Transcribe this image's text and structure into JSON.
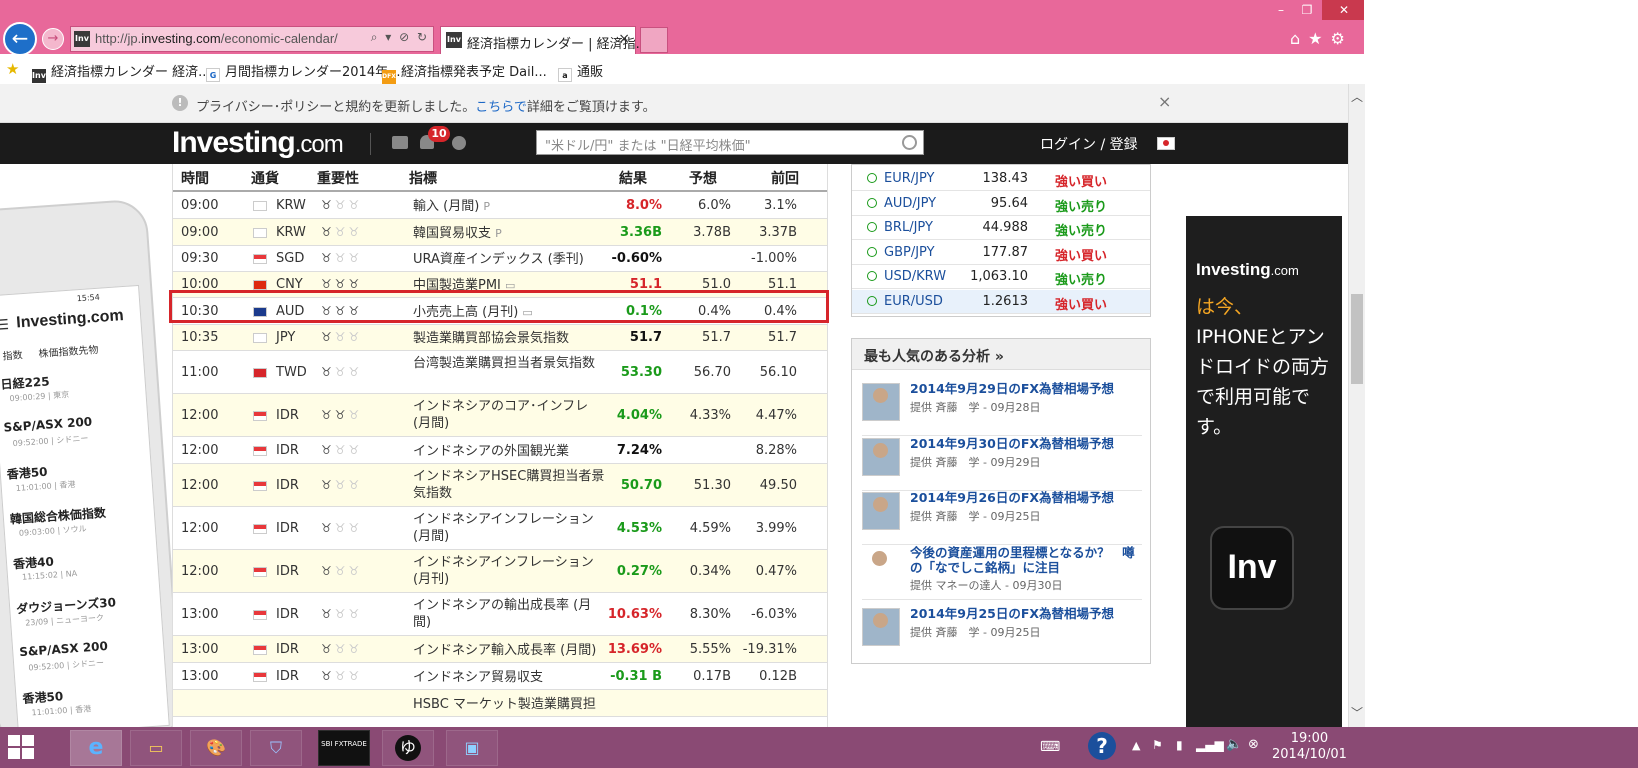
{
  "browser": {
    "url_prefix": "http://jp.",
    "url_domain": "investing.com",
    "url_path": "/economic-calendar/",
    "url_icons": "⌕ ▾ ⊘ ↻",
    "tab_title": "経済指標カレンダー | 経済指...",
    "tab_close": "×",
    "favicon_text": "Inv",
    "win_min": "–",
    "win_restore": "❐",
    "win_close": "✕",
    "tool_icons": "⌂★⚙"
  },
  "favorites": [
    {
      "label": "経済指標カレンダー 経済...",
      "icon": "investing-favicon",
      "color": "#333333",
      "glyph": "Inv"
    },
    {
      "label": "月間指標カレンダー2014年...",
      "icon": "g-favicon",
      "color": "#ffffff",
      "glyph": "G"
    },
    {
      "label": "経済指標発表予定 Dail...",
      "icon": "dfx-favicon",
      "color": "#f39c12",
      "glyph": "DFX"
    },
    {
      "label": "通販",
      "icon": "amazon-favicon",
      "color": "#ffffff",
      "glyph": "a"
    }
  ],
  "notice": {
    "icon": "!",
    "text_before": "プライバシー･ポリシーと規約を更新しました。",
    "link": "こちらで",
    "text_after": "詳細をご覧頂けます。",
    "close": "×"
  },
  "header": {
    "logo_main": "Investing",
    "logo_suffix": ".com",
    "badge_count": "10",
    "search_placeholder": "\"米ドル/円\" または \"日経平均株価\"",
    "login": "ログイン / 登録"
  },
  "phone": {
    "time": "15:54",
    "logo": "Investing.com",
    "menu_icon": "☰",
    "tabs": [
      "指数",
      "株価指数先物"
    ],
    "rows": [
      {
        "name": "日経225",
        "sub": "09:00:29 | 東京"
      },
      {
        "name": "S&P/ASX 200",
        "sub": "09:52:00 | シドニー"
      },
      {
        "name": "香港50",
        "sub": "11:01:00 | 香港"
      },
      {
        "name": "韓国総合株価指数",
        "sub": "09:03:00 | ソウル"
      },
      {
        "name": "香港40",
        "sub": "11:15:02 | NA"
      },
      {
        "name": "ダウジョーンズ30",
        "sub": "23/09 | ニューヨーク"
      },
      {
        "name": "S&P/ASX 200",
        "sub": "09:52:00 | シドニー"
      },
      {
        "name": "香港50",
        "sub": "11:01:00 | 香港"
      }
    ]
  },
  "calendar": {
    "headers": {
      "time": "時間",
      "currency": "通貨",
      "importance": "重要性",
      "indicator": "指標",
      "actual": "結果",
      "forecast": "予想",
      "previous": "前回"
    },
    "bull_glyph": "♉",
    "rows": [
      {
        "time": "09:00",
        "flag": "KR",
        "currency": "KRW",
        "imp": 1,
        "indicator": "輸入 (月間)",
        "tag": "P",
        "actual": "8.0%",
        "ac": "red",
        "forecast": "6.0%",
        "previous": "3.1%"
      },
      {
        "time": "09:00",
        "flag": "KR",
        "currency": "KRW",
        "imp": 1,
        "indicator": "韓国貿易収支",
        "tag": "P",
        "actual": "3.36B",
        "ac": "green",
        "forecast": "3.78B",
        "previous": "3.37B"
      },
      {
        "time": "09:30",
        "flag": "SG",
        "currency": "SGD",
        "imp": 1,
        "indicator": "URA資産インデックス (季刊)",
        "tag": "",
        "actual": "-0.60%",
        "ac": "black",
        "forecast": "",
        "previous": "-1.00%"
      },
      {
        "time": "10:00",
        "flag": "CN",
        "currency": "CNY",
        "imp": 3,
        "indicator": "中国製造業PMI",
        "tag": "bubble",
        "actual": "51.1",
        "ac": "red",
        "forecast": "51.0",
        "previous": "51.1"
      },
      {
        "time": "10:30",
        "flag": "AU",
        "currency": "AUD",
        "imp": 3,
        "indicator": "小売売上高 (月刊)",
        "tag": "bubble",
        "actual": "0.1%",
        "ac": "green",
        "forecast": "0.4%",
        "previous": "0.4%"
      },
      {
        "time": "10:35",
        "flag": "JP",
        "currency": "JPY",
        "imp": 1,
        "indicator": "製造業購買部協会景気指数",
        "tag": "",
        "actual": "51.7",
        "ac": "black",
        "forecast": "51.7",
        "previous": "51.7"
      },
      {
        "time": "11:00",
        "flag": "TW",
        "currency": "TWD",
        "imp": 1,
        "indicator": "台湾製造業購買担当者景気指数",
        "tag": "",
        "actual": "53.30",
        "ac": "green",
        "forecast": "56.70",
        "previous": "56.10"
      },
      {
        "time": "12:00",
        "flag": "ID",
        "currency": "IDR",
        "imp": 2,
        "indicator": "インドネシアのコア･インフレ (月間)",
        "tag": "",
        "actual": "4.04%",
        "ac": "green",
        "forecast": "4.33%",
        "previous": "4.47%"
      },
      {
        "time": "12:00",
        "flag": "ID",
        "currency": "IDR",
        "imp": 1,
        "indicator": "インドネシアの外国観光業",
        "tag": "",
        "actual": "7.24%",
        "ac": "black",
        "forecast": "",
        "previous": "8.28%"
      },
      {
        "time": "12:00",
        "flag": "ID",
        "currency": "IDR",
        "imp": 1,
        "indicator": "インドネシアHSEC購買担当者景気指数",
        "tag": "",
        "actual": "50.70",
        "ac": "green",
        "forecast": "51.30",
        "previous": "49.50"
      },
      {
        "time": "12:00",
        "flag": "ID",
        "currency": "IDR",
        "imp": 1,
        "indicator": "インドネシアインフレーション (月間)",
        "tag": "",
        "actual": "4.53%",
        "ac": "green",
        "forecast": "4.59%",
        "previous": "3.99%"
      },
      {
        "time": "12:00",
        "flag": "ID",
        "currency": "IDR",
        "imp": 1,
        "indicator": "インドネシアインフレーション (月刊)",
        "tag": "",
        "actual": "0.27%",
        "ac": "green",
        "forecast": "0.34%",
        "previous": "0.47%"
      },
      {
        "time": "13:00",
        "flag": "ID",
        "currency": "IDR",
        "imp": 1,
        "indicator": "インドネシアの輸出成長率 (月間)",
        "tag": "",
        "actual": "10.63%",
        "ac": "red",
        "forecast": "8.30%",
        "previous": "-6.03%"
      },
      {
        "time": "13:00",
        "flag": "ID",
        "currency": "IDR",
        "imp": 1,
        "indicator": "インドネシア輸入成長率 (月間)",
        "tag": "",
        "actual": "13.69%",
        "ac": "red",
        "forecast": "5.55%",
        "previous": "-19.31%"
      },
      {
        "time": "13:00",
        "flag": "ID",
        "currency": "IDR",
        "imp": 1,
        "indicator": "インドネシア貿易収支",
        "tag": "",
        "actual": "-0.31 B",
        "ac": "green",
        "forecast": "0.17B",
        "previous": "0.12B"
      },
      {
        "time": "",
        "flag": "",
        "currency": "",
        "imp": 0,
        "indicator": "HSBC マーケット製造業購買担",
        "tag": "",
        "actual": "",
        "ac": "black",
        "forecast": "",
        "previous": ""
      }
    ]
  },
  "pairs": [
    {
      "name": "EUR/JPY",
      "price": "138.43",
      "signal": "強い買い",
      "sc": "red"
    },
    {
      "name": "AUD/JPY",
      "price": "95.64",
      "signal": "強い売り",
      "sc": "green"
    },
    {
      "name": "BRL/JPY",
      "price": "44.988",
      "signal": "強い売り",
      "sc": "green"
    },
    {
      "name": "GBP/JPY",
      "price": "177.87",
      "signal": "強い買い",
      "sc": "red"
    },
    {
      "name": "USD/KRW",
      "price": "1,063.10",
      "signal": "強い売り",
      "sc": "green"
    },
    {
      "name": "EUR/USD",
      "price": "1.2613",
      "signal": "強い買い",
      "sc": "red"
    }
  ],
  "popular": {
    "title": "最も人気のある分析 »",
    "articles": [
      {
        "title": "2014年9月29日のFX為替相場予想",
        "meta": "提供 斉藤　学 - 09月28日",
        "thumb": "person"
      },
      {
        "title": "2014年9月30日のFX為替相場予想",
        "meta": "提供 斉藤　学 - 09月29日",
        "thumb": "person"
      },
      {
        "title": "2014年9月26日のFX為替相場予想",
        "meta": "提供 斉藤　学 - 09月25日",
        "thumb": "person"
      },
      {
        "title": "今後の資産運用の里程標となるか？　噂の「なでしこ銘柄」に注目",
        "meta": "提供 マネーの達人 - 09月30日",
        "thumb": "logo"
      },
      {
        "title": "2014年9月25日のFX為替相場予想",
        "meta": "提供 斉藤　学 - 09月25日",
        "thumb": "person"
      }
    ]
  },
  "ad": {
    "logo_main": "Investing",
    "logo_suffix": ".com",
    "line1": "は今、",
    "line2": "IPHONEとアンドロイドの両方で利用可能です。",
    "app_label": "Inv"
  },
  "taskbar": {
    "apps": [
      "internet-explorer",
      "file-explorer",
      "paint",
      "shield-app",
      "sbi-fxtrade",
      "yu-app",
      "photo-viewer"
    ],
    "sbi_label": "SBI FXTRADE",
    "yu_label": "ゆ",
    "time": "19:00",
    "date": "2014/10/01"
  }
}
